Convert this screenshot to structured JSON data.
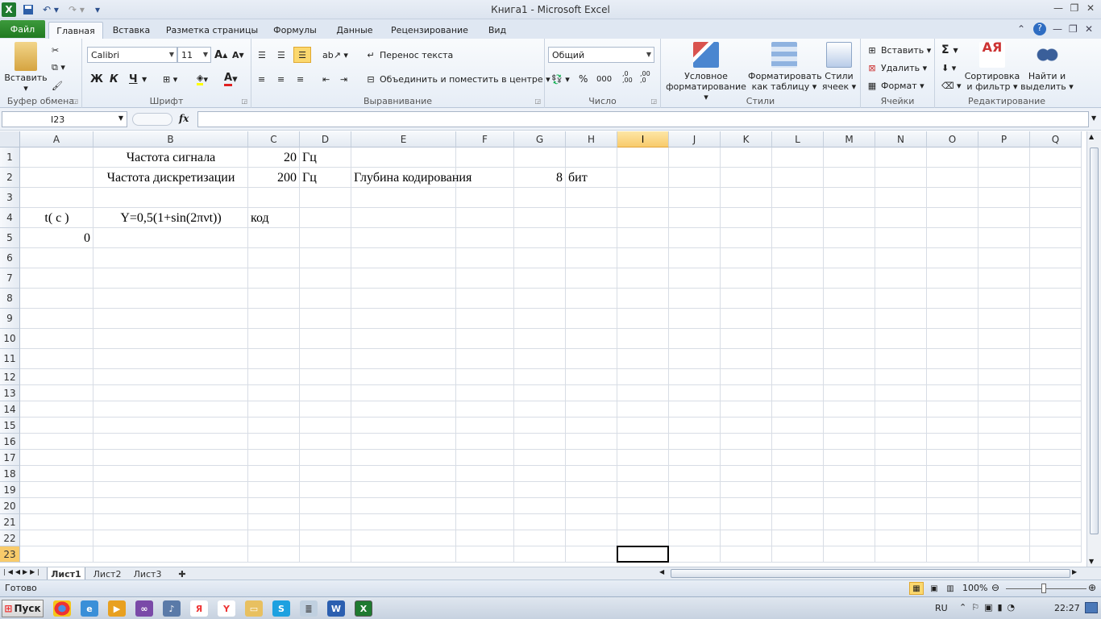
{
  "window": {
    "title": "Книга1 - Microsoft Excel"
  },
  "tabs": {
    "file": "Файл",
    "items": [
      "Главная",
      "Вставка",
      "Разметка страницы",
      "Формулы",
      "Данные",
      "Рецензирование",
      "Вид"
    ],
    "active": "Главная"
  },
  "ribbon": {
    "clipboard": {
      "label": "Буфер обмена",
      "paste": "Вставить"
    },
    "font": {
      "label": "Шрифт",
      "name": "Calibri",
      "size": "11",
      "bold": "Ж",
      "italic": "К",
      "underline": "Ч",
      "grow": "A",
      "shrink": "A"
    },
    "alignment": {
      "label": "Выравнивание",
      "wrap": "Перенос текста",
      "merge": "Объединить и поместить в центре"
    },
    "number": {
      "label": "Число",
      "format": "Общий",
      "percent": "%",
      "thousands": "000",
      "inc_decimal": ",0 ,00",
      "dec_decimal": ",00 ,0"
    },
    "styles": {
      "label": "Стили",
      "conditional": [
        "Условное",
        "форматирование"
      ],
      "astable": [
        "Форматировать",
        "как таблицу"
      ],
      "cellstyles": [
        "Стили",
        "ячеек"
      ]
    },
    "cells": {
      "label": "Ячейки",
      "insert": "Вставить",
      "delete": "Удалить",
      "format": "Формат"
    },
    "editing": {
      "label": "Редактирование",
      "sort": [
        "Сортировка",
        "и фильтр"
      ],
      "find": [
        "Найти и",
        "выделить"
      ],
      "sigma": "Σ"
    }
  },
  "formula_bar": {
    "namebox": "I23",
    "fx": "fx",
    "value": ""
  },
  "columns": [
    "A",
    "B",
    "C",
    "D",
    "E",
    "F",
    "G",
    "H",
    "I",
    "J",
    "K",
    "L",
    "M",
    "N",
    "O",
    "P",
    "Q"
  ],
  "selected_column": "I",
  "rows": [
    "1",
    "2",
    "3",
    "4",
    "5",
    "6",
    "7",
    "8",
    "9",
    "10",
    "11",
    "12",
    "13",
    "14",
    "15",
    "16",
    "17",
    "18",
    "19",
    "20",
    "21",
    "22",
    "23"
  ],
  "selected_row": "23",
  "cells": {
    "B1": "Частота сигнала",
    "C1": "20",
    "D1": "Гц",
    "B2": "Частота дискретизации",
    "C2": "200",
    "D2": "Гц",
    "E2": "Глубина кодирования",
    "G2": "8",
    "H2": "бит",
    "A4": "t( с )",
    "B4": "Y=0,5(1+sin(2πνt))",
    "C4": "код",
    "A5": "0"
  },
  "sheets": [
    "Лист1",
    "Лист2",
    "Лист3"
  ],
  "active_sheet": "Лист1",
  "status": {
    "ready": "Готово",
    "zoom": "100%"
  },
  "taskbar": {
    "start": "Пуск",
    "lang": "RU",
    "time": "22:27"
  }
}
